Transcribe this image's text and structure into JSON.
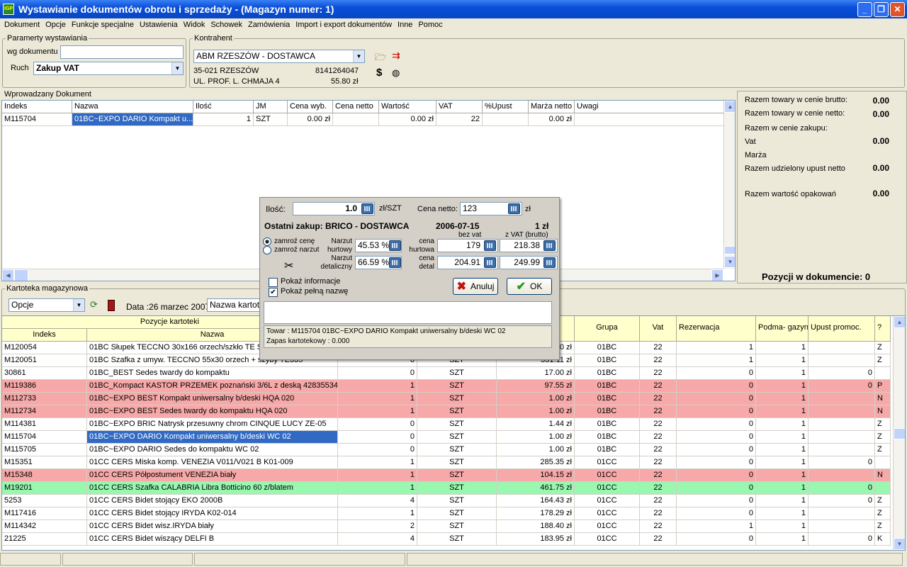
{
  "window": {
    "title": "Wystawianie dokumentów obrotu i sprzedaży -  (Magazyn numer: 1)",
    "icon_label": "IGP"
  },
  "menu": [
    "Dokument",
    "Opcje",
    "Funkcje specjalne",
    "Ustawienia",
    "Widok",
    "Schowek",
    "Zamówienia",
    "Import i export dokumentów",
    "Inne",
    "Pomoc"
  ],
  "params": {
    "legend": "Paramerty wystawiania",
    "wg_label": "wg dokumentu",
    "wg_value": "",
    "ruch_label": "Ruch",
    "ruch_value": "Zakup VAT"
  },
  "kontrahent": {
    "legend": "Kontrahent",
    "name": "ABM RZESZÓW - DOSTAWCA",
    "city": "35-021 RZESZÓW",
    "nip": "8141264047",
    "street": "UL. PROF. L. CHMAJA 4",
    "amount": "55.80 zł"
  },
  "doc": {
    "legend": "Wprowadzany Dokument",
    "headers": [
      "Indeks",
      "Nazwa",
      "Ilość",
      "JM",
      "Cena wyb.",
      "Cena netto",
      "Wartość",
      "VAT",
      "%Upust",
      "Marża netto",
      "Uwagi"
    ],
    "row": [
      "M115704",
      "01BC~EXPO DARIO Kompakt u...",
      "1",
      "SZT",
      "0.00 zł",
      "",
      "0.00 zł",
      "22",
      "",
      "0.00 zł",
      ""
    ]
  },
  "summary": {
    "brutto_label": "Razem towary w cenie brutto:",
    "brutto": "0.00",
    "netto_label": "Razem towary w cenie netto:",
    "netto": "0.00",
    "zakup_label": "Razem w cenie zakupu:",
    "vat_label": "Vat",
    "vat": "0.00",
    "marza_label": "Marża",
    "upust_label": "Razem udzielony upust netto",
    "upust": "0.00",
    "opak_label": "Razem wartość opakowań",
    "opak": "0.00",
    "pozycji": "Pozycji w dokumencie: 0"
  },
  "kartoteka": {
    "legend": "Kartoteka magazynowa",
    "opcje": "Opcje",
    "data_label": "Data :26 marzec 2007",
    "sort_value": "Nazwa kartotek",
    "group_header": "Pozycje kartoteki",
    "headers": [
      "Indeks",
      "Nazwa",
      "",
      "",
      "",
      "Grupa",
      "Vat",
      "Rezerwacja",
      "Podma- gazyn",
      "Upust promoc.",
      "?"
    ],
    "rows": [
      {
        "c": [
          "M120054",
          "01BC Słupek TECCNO 30x166 orzech/szkło TE S",
          "",
          "",
          "0 zł",
          "01BC",
          "22",
          "1",
          "1",
          "",
          "Z"
        ],
        "bg": "#ffffff"
      },
      {
        "c": [
          "M120051",
          "01BC Szafka z umyw. TECCNO 55x30 orzech + szyby TE335",
          "0",
          "SZT",
          "331.11 zł",
          "01BC",
          "22",
          "1",
          "1",
          "",
          "Z"
        ],
        "bg": "#ffffff"
      },
      {
        "c": [
          "30861",
          "01BC_BEST Sedes twardy do kompaktu",
          "0",
          "SZT",
          "17.00 zł",
          "01BC",
          "22",
          "0",
          "1",
          "0",
          ""
        ],
        "bg": "#ffffff"
      },
      {
        "c": [
          "M119386",
          "01BC_Kompact KASTOR PRZEMEK poznański 3/6L z deską 42835534",
          "1",
          "SZT",
          "97.55 zł",
          "01BC",
          "22",
          "0",
          "1",
          "0",
          "P"
        ],
        "bg": "#f7a8a8"
      },
      {
        "c": [
          "M112733",
          "01BC~EXPO BEST Kompakt uniwersalny b/deski HQA 020",
          "1",
          "SZT",
          "1.00 zł",
          "01BC",
          "22",
          "0",
          "1",
          "",
          "N"
        ],
        "bg": "#f7a8a8"
      },
      {
        "c": [
          "M112734",
          "01BC~EXPO BEST Sedes twardy do kompaktu HQA 020",
          "1",
          "SZT",
          "1.00 zł",
          "01BC",
          "22",
          "0",
          "1",
          "",
          "N"
        ],
        "bg": "#f7a8a8"
      },
      {
        "c": [
          "M114381",
          "01BC~EXPO BRIC Natrysk przesuwny chrom  CINQUE LUCY  ZE-05",
          "0",
          "SZT",
          "1.44 zł",
          "01BC",
          "22",
          "0",
          "1",
          "",
          "Z"
        ],
        "bg": "#ffffff"
      },
      {
        "c": [
          "M115704",
          "01BC~EXPO DARIO Kompakt uniwersalny b/deski WC 02",
          "0",
          "SZT",
          "1.00 zł",
          "01BC",
          "22",
          "0",
          "1",
          "",
          "Z"
        ],
        "bg": "#ffffff",
        "sel": true
      },
      {
        "c": [
          "M115705",
          "01BC~EXPO DARIO Sedes do kompaktu WC 02",
          "0",
          "SZT",
          "1.00 zł",
          "01BC",
          "22",
          "0",
          "1",
          "",
          "Z"
        ],
        "bg": "#ffffff"
      },
      {
        "c": [
          "M15351",
          "01CC  CERS Miska komp. VENEZIA V011/V021 B K01-009",
          "1",
          "SZT",
          "285.35 zł",
          "01CC",
          "22",
          "0",
          "1",
          "0",
          ""
        ],
        "bg": "#ffffff"
      },
      {
        "c": [
          "M15348",
          "01CC  CERS Półpostument VENEZIA biały",
          "1",
          "SZT",
          "104.15 zł",
          "01CC",
          "22",
          "0",
          "1",
          "",
          "N"
        ],
        "bg": "#f7a8a8"
      },
      {
        "c": [
          "M19201",
          "01CC CERS  Szafka CALABRIA Libra Botticino 60 z/blatem",
          "1",
          "SZT",
          "461.75 zł",
          "01CC",
          "22",
          "0",
          "1",
          "0",
          ""
        ],
        "bg": "#99f7b0"
      },
      {
        "c": [
          "5253",
          "01CC CERS Bidet stojący EKO 2000B",
          "4",
          "SZT",
          "164.43 zł",
          "01CC",
          "22",
          "0",
          "1",
          "0",
          "Z"
        ],
        "bg": "#ffffff"
      },
      {
        "c": [
          "M117416",
          "01CC CERS Bidet stojący IRYDA K02-014",
          "1",
          "SZT",
          "178.29 zł",
          "01CC",
          "22",
          "0",
          "1",
          "",
          "Z"
        ],
        "bg": "#ffffff"
      },
      {
        "c": [
          "M114342",
          "01CC CERS Bidet wisz.IRYDA biały",
          "2",
          "SZT",
          "188.40 zł",
          "01CC",
          "22",
          "1",
          "1",
          "",
          "Z"
        ],
        "bg": "#ffffff"
      },
      {
        "c": [
          "21225",
          "01CC CERS Bidet wiszący DELFI B",
          "4",
          "SZT",
          "183.95 zł",
          "01CC",
          "22",
          "0",
          "1",
          "0",
          "K"
        ],
        "bg": "#ffffff"
      }
    ]
  },
  "dialog": {
    "ilosc_label": "Ilość:",
    "ilosc": "1.0",
    "unit": "zł/SZT",
    "cena_netto_label": "Cena netto:",
    "cena_netto": "123",
    "zl": "zł",
    "ostatni": "Ostatni zakup: BRICO - DOSTAWCA",
    "date": "2006-07-15",
    "last_price": "1 zł",
    "bez_vat": "bez vat",
    "z_vat": "z VAT (brutto)",
    "zamroz_cene": "zamroź cenę",
    "zamroz_narzut": "zamroź narzut",
    "narzut_hurt_label": "Narzut hurtowy",
    "narzut_hurt": "45.53 %",
    "narzut_det_label": "Narzut detaliczny",
    "narzut_det": "66.59 %",
    "cena_hurt_label": "cena hurtowa",
    "hurt_netto": "179",
    "hurt_brutto": "218.38",
    "cena_det_label": "cena detal",
    "det_netto": "204.91",
    "det_brutto": "249.99",
    "pokaz_info": "Pokaż informacje",
    "pokaz_nazwe": "Pokaż pełną nazwę",
    "anuluj": "Anuluj",
    "ok": "OK",
    "towar": "Towar : M115704 01BC~EXPO DARIO Kompakt uniwersalny b/deski WC 02",
    "zapas": "Zapas kartotekowy :      0.000"
  }
}
